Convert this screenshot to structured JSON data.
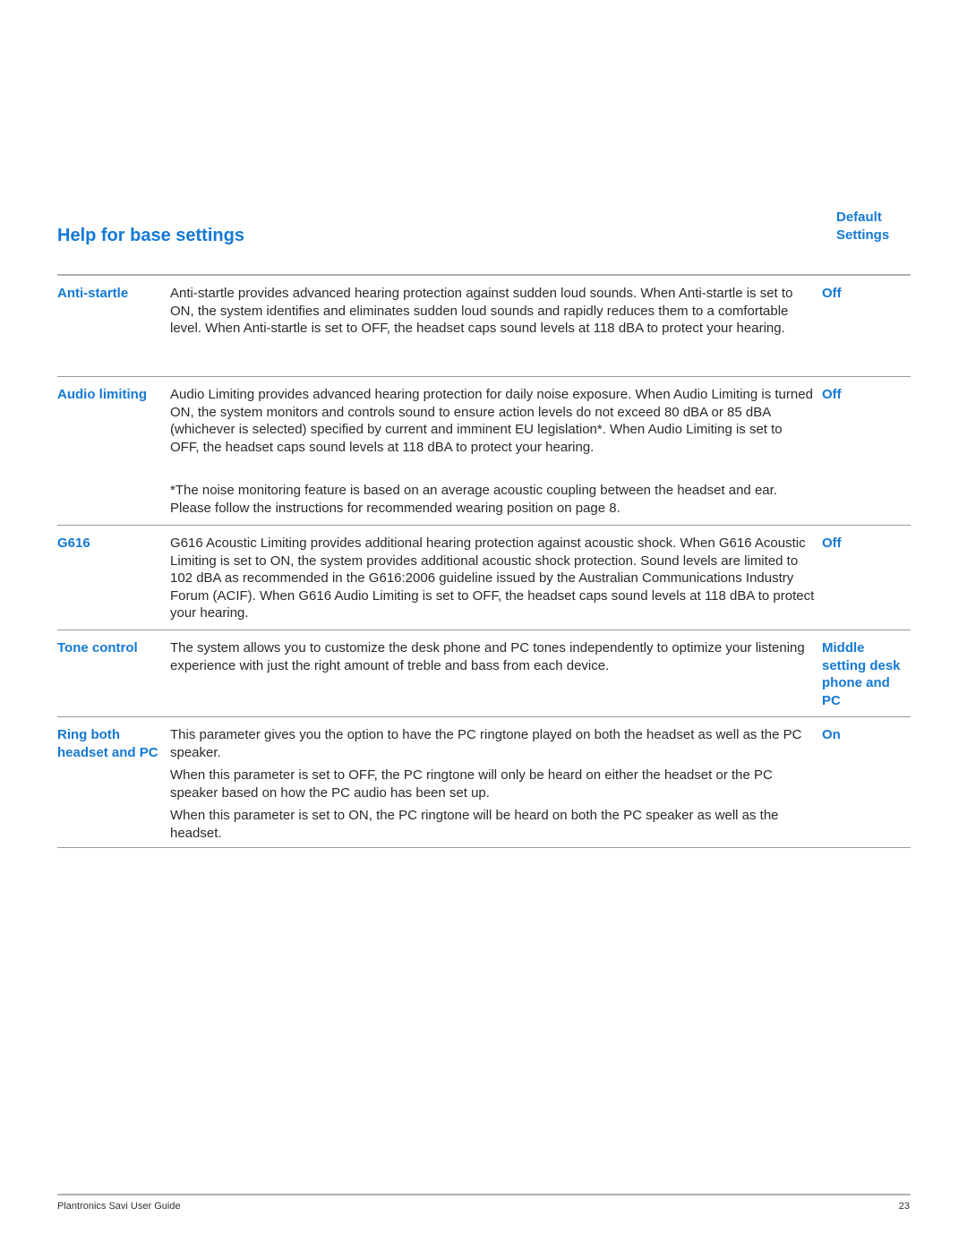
{
  "page": {
    "title": "Help for base settings",
    "default_header": [
      "Default",
      "Settings"
    ],
    "rows": [
      {
        "name": "Anti-startle",
        "paragraphs": [
          "Anti-startle provides advanced hearing protection against sudden loud sounds. When Anti-startle is set to ON, the system identifies and eliminates sudden loud sounds and rapidly reduces them to a comfortable level. When Anti-startle is set to OFF, the headset caps sound levels at 118 dBA to protect your hearing."
        ],
        "default": "Off"
      },
      {
        "name": "Audio limiting",
        "paragraphs": [
          "Audio Limiting provides advanced hearing protection for daily noise exposure. When Audio Limiting is turned ON, the system monitors and controls sound to ensure action levels do not exceed 80 dBA or 85 dBA (whichever is selected) specified by current and imminent EU legislation*. When Audio Limiting is set to OFF, the headset caps sound levels at 118 dBA to protect your hearing.",
          "*The noise monitoring feature is based on an average acoustic coupling between the headset and ear. Please follow the instructions for recommended wearing position on page 8."
        ],
        "default": "Off"
      },
      {
        "name": "G616",
        "paragraphs": [
          "G616 Acoustic Limiting provides additional hearing protection against acoustic shock. When G616 Acoustic Limiting is set to ON, the system provides additional acoustic shock protection. Sound levels are limited to 102 dBA as recommended in the G616:2006 guideline issued by the Australian Communications Industry Forum (ACIF). When G616 Audio Limiting is set to OFF, the headset caps sound levels at 118 dBA to protect your hearing."
        ],
        "default": "Off"
      },
      {
        "name": "Tone control",
        "paragraphs": [
          "The system allows you to customize the desk phone and PC tones independently to optimize your listening experience with just the right amount of treble and bass from each device."
        ],
        "default": "Middle setting desk phone and PC"
      },
      {
        "name": "Ring both headset and PC",
        "paragraphs": [
          "This parameter gives you the option to have the PC ringtone played on both the headset as well as the PC speaker.",
          "When this parameter is set to OFF, the PC ringtone will only be heard on either the headset or the PC speaker based on how the PC audio has been set up.",
          "When this parameter is set to ON, the PC ringtone will be heard on both the PC speaker as well as the headset."
        ],
        "default": "On"
      }
    ]
  },
  "footer": {
    "guide_name": "Plantronics Savi User Guide",
    "page_number": "23"
  },
  "colors": {
    "accent": "#1479d4",
    "rule": "#9a9a9a"
  }
}
